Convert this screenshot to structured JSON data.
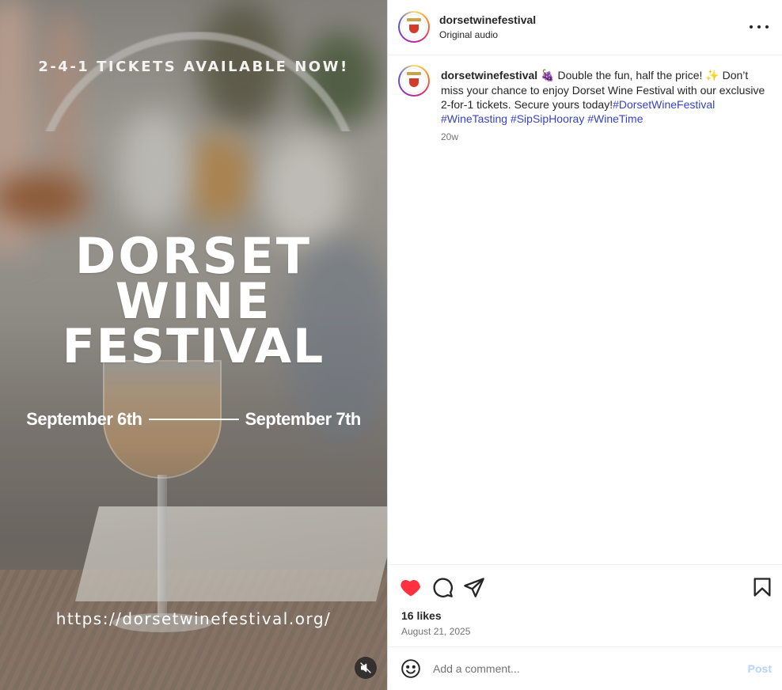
{
  "media": {
    "promo": "2-4-1 TICKETS AVAILABLE NOW!",
    "title_lines": [
      "DORSET",
      "WINE",
      "FESTIVAL"
    ],
    "date_start": "September 6th",
    "date_end": "September 7th",
    "url": "https://dorsetwinefestival.org/",
    "mute_icon": "speaker-muted-icon"
  },
  "header": {
    "username": "dorsetwinefestival",
    "subtitle": "Original audio",
    "more_icon": "more-options-icon"
  },
  "caption": {
    "username": "dorsetwinefestival",
    "emoji_1": "🍇",
    "text_1": " Double the fun, half the price! ",
    "emoji_2": "✨",
    "text_2": " Don’t miss your chance to enjoy Dorset Wine Festival with our exclusive 2-for-1 tickets. Secure yours today!",
    "hashtags": [
      "#DorsetWineFestival",
      "#WineTasting",
      "#SipSipHooray",
      "#WineTime"
    ],
    "age": "20w"
  },
  "actions": {
    "liked": true,
    "like_color": "#ff3040",
    "likes": "16 likes",
    "date": "August 21, 2025"
  },
  "comment": {
    "placeholder": "Add a comment...",
    "post_label": "Post"
  }
}
